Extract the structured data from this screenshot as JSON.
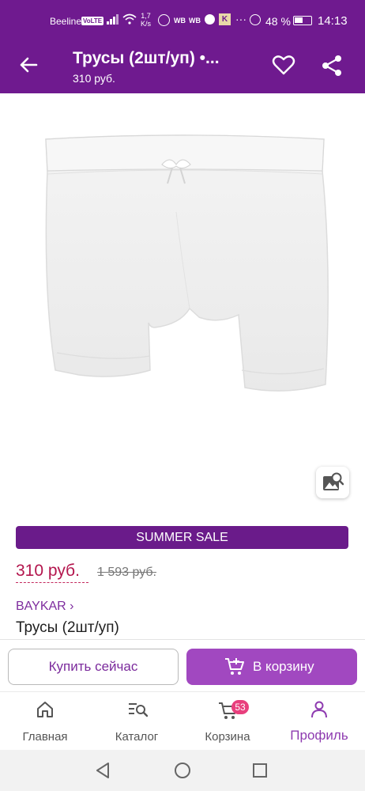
{
  "status_bar": {
    "carrier": "Beeline",
    "volte": "VoLTE",
    "speed_value": "1,7",
    "speed_unit": "K/s",
    "wb1": "WB",
    "wb2": "WB",
    "app_letter": "K",
    "overflow": "···",
    "battery": "48 %",
    "time": "14:13"
  },
  "header": {
    "title": "Трусы (2шт/уп) •...",
    "subtitle": "310 руб."
  },
  "product": {
    "sale_label": "SUMMER SALE",
    "price": "310 руб.",
    "old_price": "1 593 руб.",
    "brand": "BAYKAR ›",
    "name": "Трусы (2шт/уп)"
  },
  "actions": {
    "buy_now": "Купить сейчас",
    "add_to_cart": "В корзину"
  },
  "bottom_nav": {
    "home": "Главная",
    "catalog": "Каталог",
    "cart": "Корзина",
    "cart_count": "53",
    "profile": "Профиль"
  },
  "colors": {
    "brand": "#6f1a8f",
    "price": "#b3154d",
    "cart_button": "#a148c0",
    "badge": "#e83f7d"
  }
}
